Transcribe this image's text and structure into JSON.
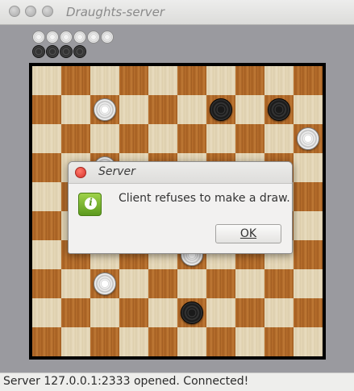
{
  "window": {
    "title": "Draughts-server"
  },
  "captured": {
    "white_count": 6,
    "black_count": 4
  },
  "board": {
    "size": 10,
    "pieces": [
      {
        "row": 1,
        "col": 2,
        "color": "white"
      },
      {
        "row": 1,
        "col": 6,
        "color": "black"
      },
      {
        "row": 1,
        "col": 8,
        "color": "black"
      },
      {
        "row": 2,
        "col": 9,
        "color": "white"
      },
      {
        "row": 3,
        "col": 2,
        "color": "white"
      },
      {
        "row": 6,
        "col": 5,
        "color": "white"
      },
      {
        "row": 7,
        "col": 2,
        "color": "white"
      },
      {
        "row": 8,
        "col": 5,
        "color": "black"
      }
    ]
  },
  "dialog": {
    "title": "Server",
    "icon": "info-icon",
    "message": "Client refuses to make a draw.",
    "ok_label": "OK"
  },
  "status": {
    "text": "Server 127.0.0.1:2333 opened. Connected!"
  }
}
